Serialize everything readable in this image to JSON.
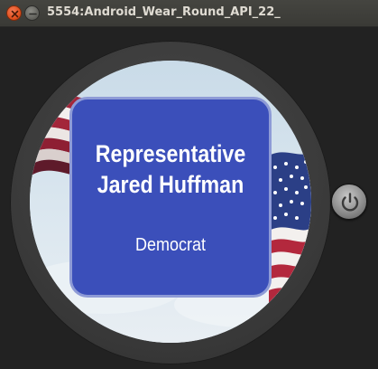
{
  "window": {
    "title": "5554:Android_Wear_Round_API_22_",
    "controls": {
      "close_icon": "close-icon",
      "minimize_icon": "minimize-icon"
    }
  },
  "watch": {
    "card": {
      "title_line1": "Representative",
      "title_line2": "Jared Huffman",
      "party": "Democrat",
      "card_color": "#3b4fba",
      "card_border_color": "#8e9bd6"
    },
    "background_image": "american-flag-sky",
    "power_button_icon": "power-icon"
  }
}
